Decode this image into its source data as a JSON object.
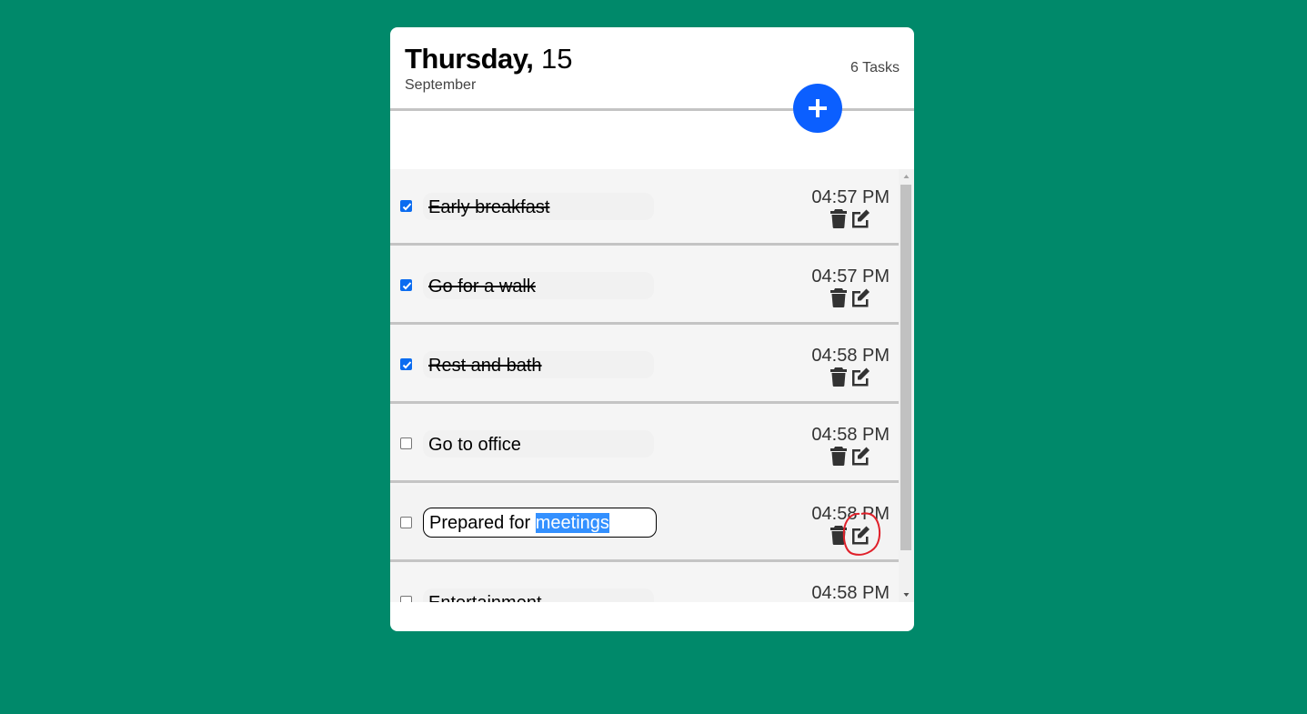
{
  "header": {
    "day_name": "Thursday,",
    "day_number": "15",
    "month": "September",
    "task_count": "6 Tasks"
  },
  "add_button": {
    "icon": "plus-icon",
    "color": "#0b5fff"
  },
  "tasks": [
    {
      "text": "Early breakfast",
      "time": "04:57 PM",
      "done": true
    },
    {
      "text": "Go for a walk",
      "time": "04:57 PM",
      "done": true
    },
    {
      "text": "Rest and bath",
      "time": "04:58 PM",
      "done": true
    },
    {
      "text": "Go to office",
      "time": "04:58 PM",
      "done": false
    },
    {
      "text_before": "Prepared for ",
      "text_selected": "meetings",
      "time": "04:58 PM",
      "done": false,
      "editing": true
    },
    {
      "text": "Entertainment",
      "time": "04:58 PM",
      "done": false
    }
  ],
  "icons": {
    "delete": "trash-icon",
    "edit": "edit-icon"
  },
  "colors": {
    "background": "#00896a",
    "accent": "#0b5fff",
    "checkbox": "#0b6cf0",
    "annotation": "#e0202a"
  }
}
